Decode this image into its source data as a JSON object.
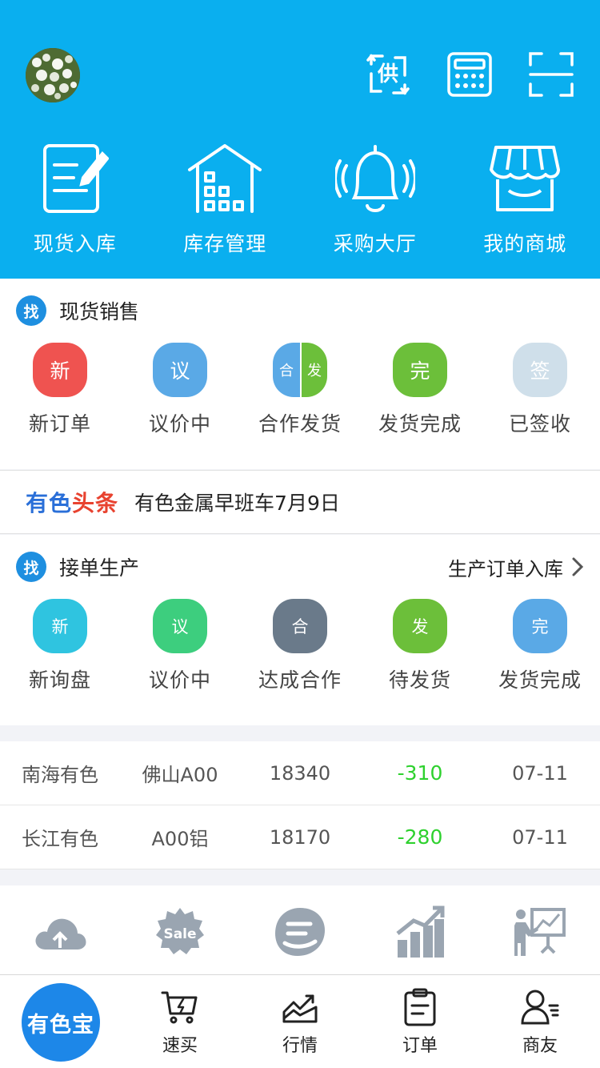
{
  "header": {
    "top_icons": [
      {
        "icon": "supply-exchange-icon",
        "glyph": "供"
      },
      {
        "icon": "calculator-icon"
      },
      {
        "icon": "scan-icon"
      }
    ],
    "nav": [
      {
        "label": "现货入库",
        "icon": "document-edit-icon"
      },
      {
        "label": "库存管理",
        "icon": "warehouse-icon"
      },
      {
        "label": "采购大厅",
        "icon": "bell-icon"
      },
      {
        "label": "我的商城",
        "icon": "shop-icon"
      }
    ]
  },
  "spot_sales": {
    "badge": "找",
    "title": "现货销售",
    "items": [
      {
        "glyph": "新",
        "label": "新订单",
        "color": "#ef5350"
      },
      {
        "glyph": "议",
        "label": "议价中",
        "color": "#5aa9e6"
      },
      {
        "glyph_a": "合",
        "glyph_b": "发",
        "label": "合作发货",
        "color_a": "#5aa9e6",
        "color_b": "#6cbf3a"
      },
      {
        "glyph": "完",
        "label": "发货完成",
        "color": "#6cbf3a"
      },
      {
        "glyph": "签",
        "label": "已签收",
        "color": "#cfdfea"
      }
    ]
  },
  "headline": {
    "brand_a": "有色",
    "brand_b": "头条",
    "text": "有色金属早班车7月9日"
  },
  "production": {
    "badge": "找",
    "title": "接单生产",
    "link": "生产订单入库",
    "items": [
      {
        "glyph": "新",
        "label": "新询盘",
        "color": "#2fc4e0"
      },
      {
        "glyph": "议",
        "label": "议价中",
        "color": "#3dce7e"
      },
      {
        "glyph": "合",
        "label": "达成合作",
        "color": "#6a7a8a"
      },
      {
        "glyph": "发",
        "label": "待发货",
        "color": "#6cbf3a"
      },
      {
        "glyph": "完",
        "label": "发货完成",
        "color": "#5aa9e6"
      }
    ]
  },
  "prices": [
    {
      "market": "南海有色",
      "product": "佛山A00",
      "price": "18340",
      "change": "-310",
      "date": "07-11"
    },
    {
      "market": "长江有色",
      "product": "A00铝",
      "price": "18170",
      "change": "-280",
      "date": "07-11"
    }
  ],
  "tools": [
    {
      "icon": "cloud-upload-icon"
    },
    {
      "icon": "sale-badge-icon",
      "text": "Sale"
    },
    {
      "icon": "e-logo-icon"
    },
    {
      "icon": "growth-chart-icon"
    },
    {
      "icon": "presentation-icon"
    }
  ],
  "bottom_nav": {
    "home": "有色宝",
    "items": [
      {
        "label": "速买",
        "icon": "cart-icon"
      },
      {
        "label": "行情",
        "icon": "market-trend-icon"
      },
      {
        "label": "订单",
        "icon": "clipboard-icon"
      },
      {
        "label": "商友",
        "icon": "contacts-icon"
      }
    ]
  },
  "colors": {
    "header_bg": "#0aafef",
    "accent_blue": "#1e8fe0",
    "change_green": "#2ed12e",
    "tool_gray": "#9aa5b1"
  }
}
